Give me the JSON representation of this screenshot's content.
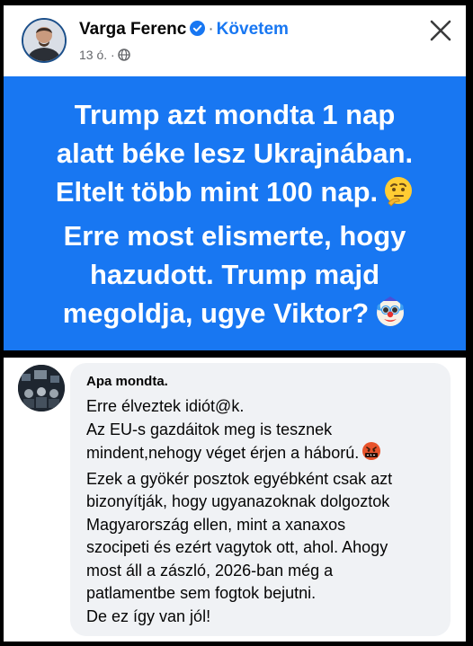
{
  "post": {
    "author": "Varga Ferenc",
    "separator": "·",
    "follow_label": "Követem",
    "time": "13 ó. ·",
    "lines": [
      "Trump  azt mondta 1 nap",
      "alatt béke lesz Ukrajnában.",
      "Eltelt több mint 100 nap.",
      "Erre most elismerte, hogy",
      "hazudott. Trump majd",
      "megoldja, ugye Viktor?"
    ],
    "emojis": [
      "thinking-face-emoji",
      "clown-face-emoji"
    ],
    "background_color": "#1877f2"
  },
  "comment": {
    "author": "Apa mondta.",
    "lines": [
      "Erre élveztek idiót@k.",
      "Az EU-s gazdáitok meg is tesznek",
      "mindent,nehogy véget érjen a háború.",
      "Ezek a gyökér posztok egyébként csak azt",
      "bizonyítják, hogy ugyanazoknak dolgoztok",
      "Magyarország ellen, mint a xanaxos",
      "szocipeti és ezért vagytok ott, ahol. Ahogy",
      "most áll a zászló, 2026-ban még a",
      "patlamentbe sem fogtok bejutni.",
      "De ez így van jól!"
    ],
    "emojis": [
      "face-with-symbols-emoji"
    ]
  },
  "icons": [
    "verified-badge-icon",
    "globe-icon",
    "close-icon"
  ]
}
